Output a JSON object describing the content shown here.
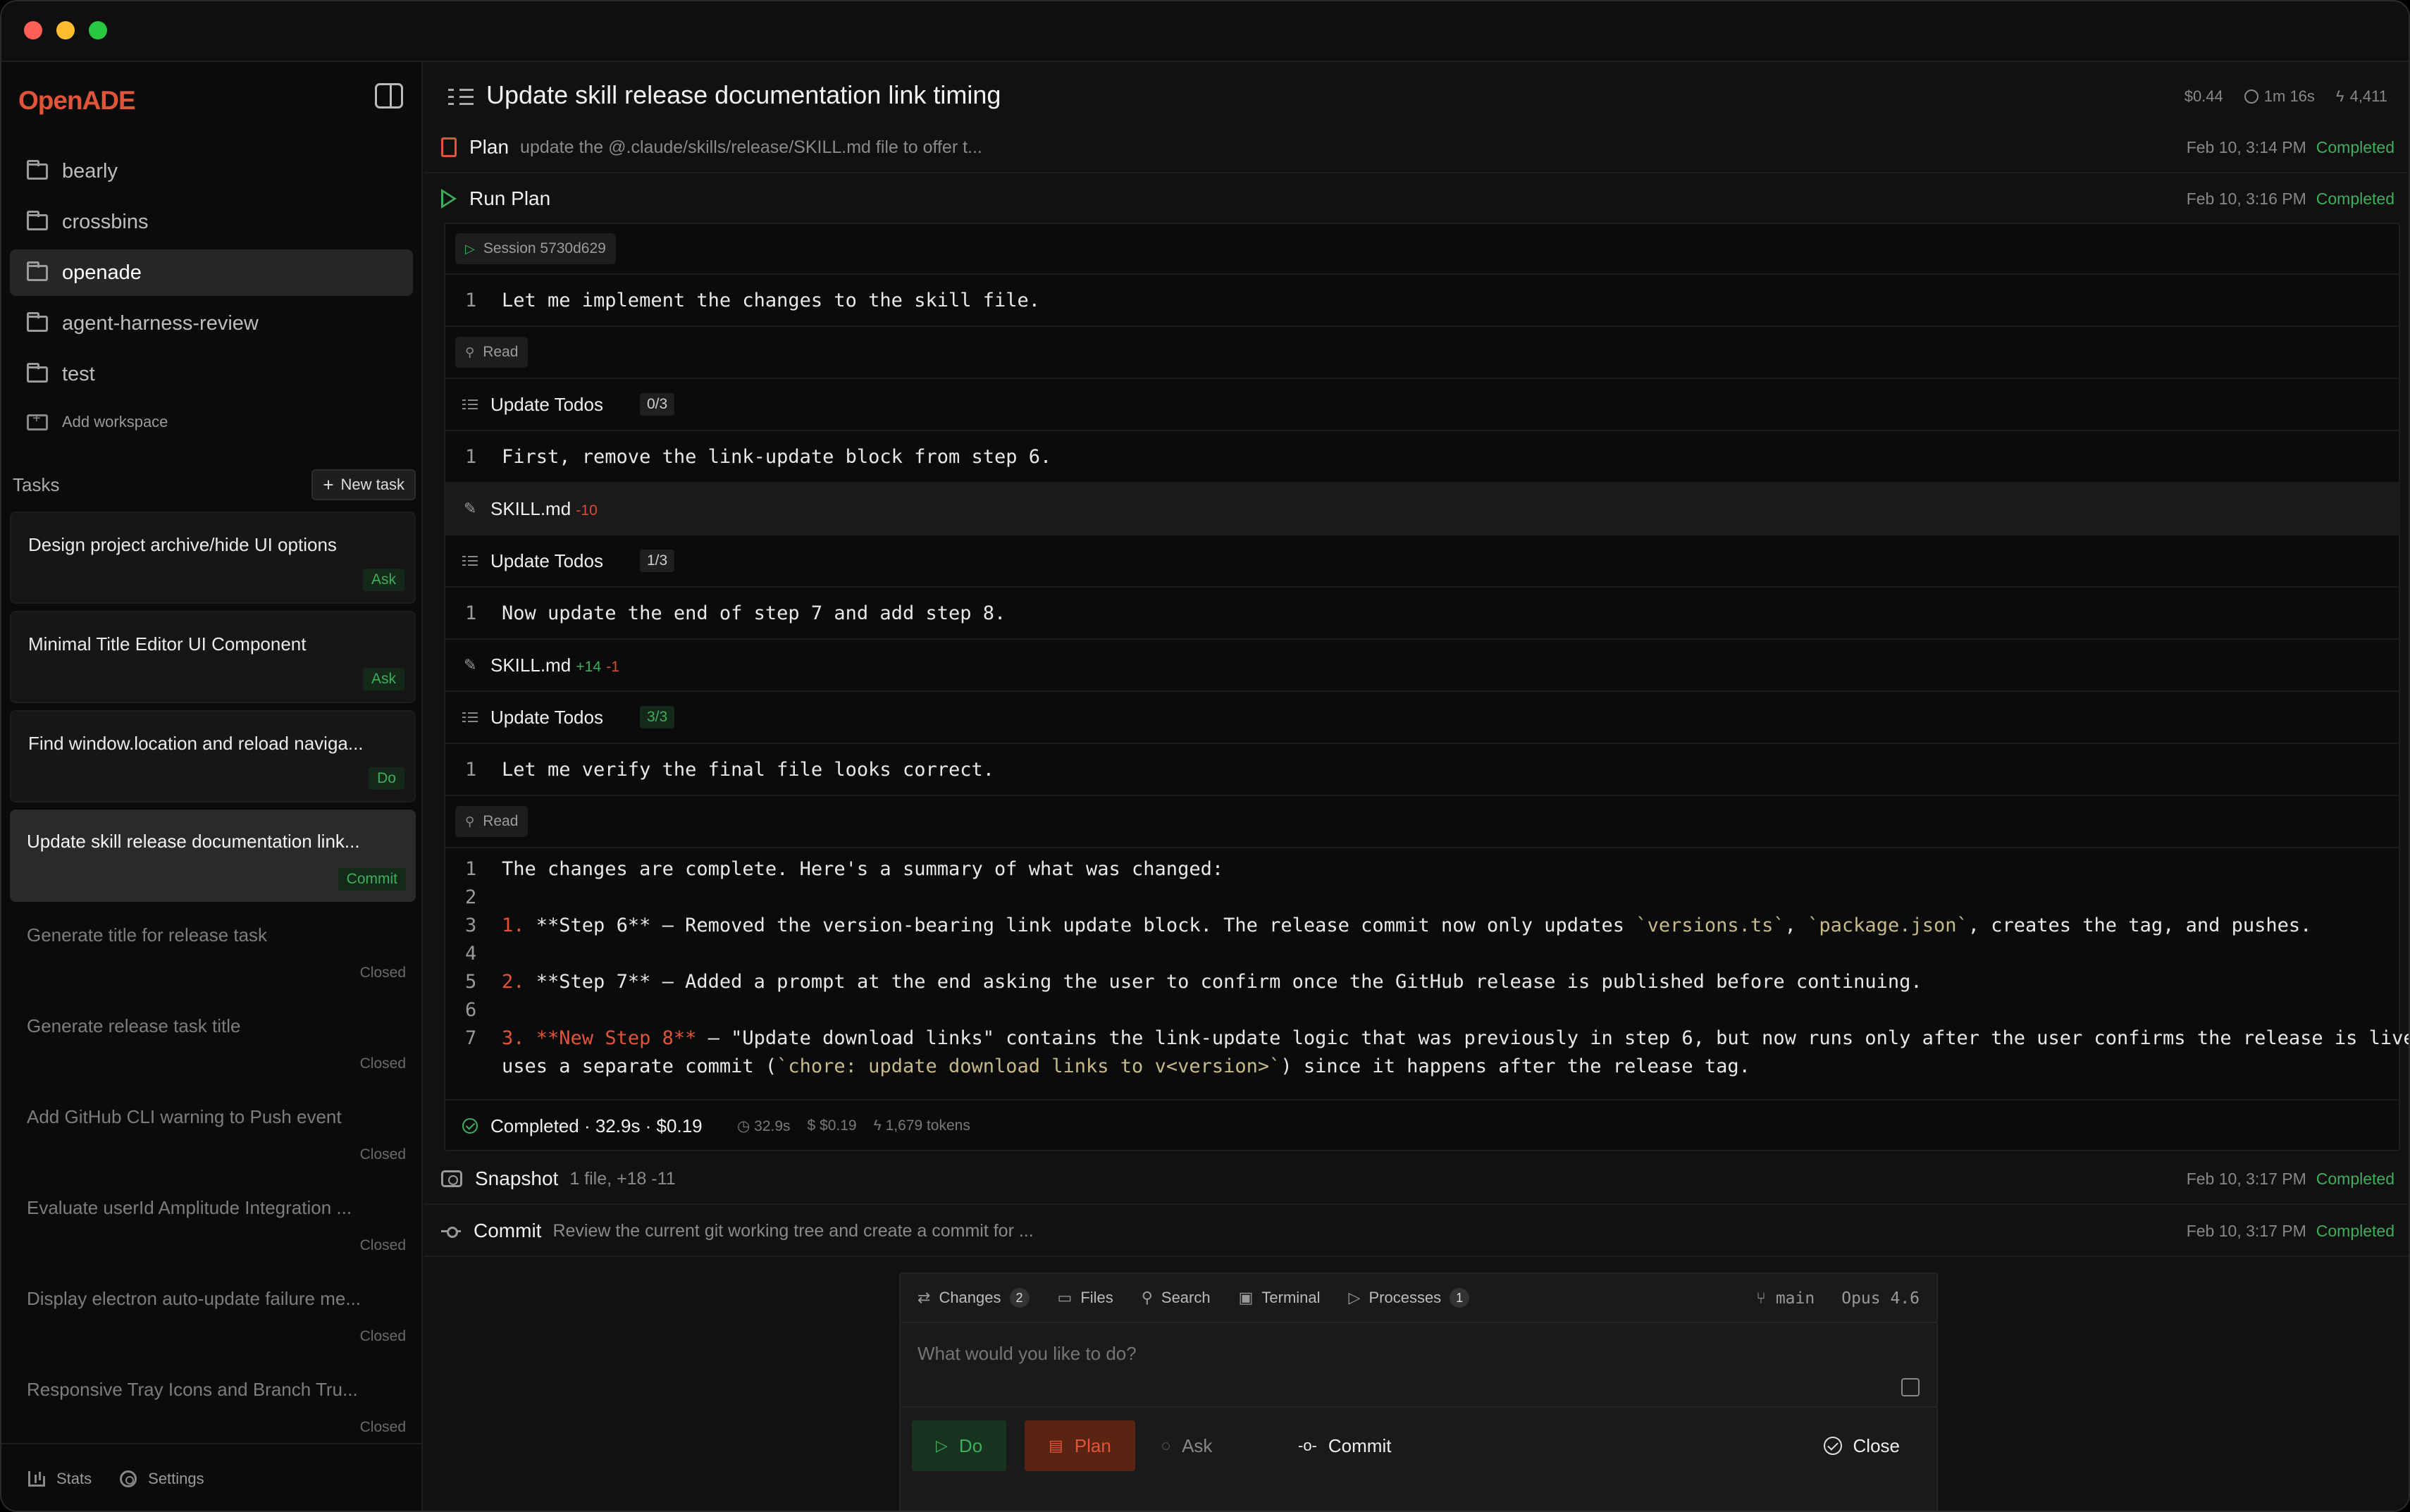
{
  "app": {
    "brand": "OpenADE"
  },
  "workspaces": [
    {
      "label": "bearly",
      "active": false
    },
    {
      "label": "crossbins",
      "active": false
    },
    {
      "label": "openade",
      "active": true
    },
    {
      "label": "agent-harness-review",
      "active": false
    },
    {
      "label": "test",
      "active": false
    }
  ],
  "add_workspace": "Add workspace",
  "tasks": {
    "title": "Tasks",
    "new_task": "New task",
    "items": [
      {
        "title": "Design project archive/hide UI options",
        "badge": "Ask",
        "state": "open"
      },
      {
        "title": "Minimal Title Editor UI Component",
        "badge": "Ask",
        "state": "open"
      },
      {
        "title": "Find window.location and reload naviga...",
        "badge": "Do",
        "state": "open"
      },
      {
        "title": "Update skill release documentation link...",
        "badge": "Commit",
        "state": "current"
      },
      {
        "title": "Generate title for release task",
        "badge": "Closed",
        "state": "closed"
      },
      {
        "title": "Generate release task title",
        "badge": "Closed",
        "state": "closed"
      },
      {
        "title": "Add GitHub CLI warning to Push event",
        "badge": "Closed",
        "state": "closed"
      },
      {
        "title": "Evaluate userId Amplitude Integration ...",
        "badge": "Closed",
        "state": "closed"
      },
      {
        "title": "Display electron auto-update failure me...",
        "badge": "Closed",
        "state": "closed"
      },
      {
        "title": "Responsive Tray Icons and Branch Tru...",
        "badge": "Closed",
        "state": "closed"
      }
    ]
  },
  "footer": {
    "stats": "Stats",
    "settings": "Settings"
  },
  "header": {
    "title": "Update skill release documentation link timing",
    "cost": "$0.44",
    "duration": "1m 16s",
    "tokens": "4,411"
  },
  "plan_row": {
    "label": "Plan",
    "desc": "update the @.claude/skills/release/SKILL.md file to offer t...",
    "time": "Feb 10, 3:14 PM",
    "status": "Completed"
  },
  "run_row": {
    "label": "Run Plan",
    "time": "Feb 10, 3:16 PM",
    "status": "Completed"
  },
  "session": {
    "chip": "Session 5730d629",
    "line1": {
      "n": "1",
      "text": "Let me implement the changes to the skill file."
    },
    "read1": "Read",
    "todos1": {
      "label": "Update Todos",
      "count": "0/3"
    },
    "line2": {
      "n": "1",
      "text": "First, remove the link-update block from step 6."
    },
    "file1": {
      "name": "SKILL.md",
      "del": "-10"
    },
    "todos2": {
      "label": "Update Todos",
      "count": "1/3"
    },
    "line3": {
      "n": "1",
      "text": "Now update the end of step 7 and add step 8."
    },
    "file2": {
      "name": "SKILL.md",
      "add": "+14",
      "del": "-1"
    },
    "todos3": {
      "label": "Update Todos",
      "count": "3/3"
    },
    "line4": {
      "n": "1",
      "text": "Let me verify the final file looks correct."
    },
    "read2": "Read",
    "summary": {
      "n1": "1",
      "t1": "The changes are complete. Here's a summary of what was changed:",
      "n2": "2",
      "n3": "3",
      "t3a": "1. ",
      "t3b": "**Step 6**",
      "t3c": " — Removed the version-bearing link update block. The release commit now only updates ",
      "t3d": "`versions.ts`",
      "t3e": ", ",
      "t3f": "`package.json`",
      "t3g": ", creates the tag, and pushes.",
      "n4": "4",
      "n5": "5",
      "t5a": "2. ",
      "t5b": "**Step 7**",
      "t5c": " — Added a prompt at the end asking the user to confirm once the GitHub release is published before continuing.",
      "n6": "6",
      "n7": "7",
      "t7a": "3. ",
      "t7b": "**New Step 8**",
      "t7c": " — \"Update download links\" contains the link-update logic that was previously in step 6, but now runs only after the user confirms the release is live. It",
      "t8a": "uses a separate commit (",
      "t8b": "`chore: update download links to v<version>`",
      "t8c": ") since it happens after the release tag."
    },
    "completed": {
      "text": "Completed · 32.9s · $0.19",
      "time": "32.9s",
      "cost": "$0.19",
      "tokens": "1,679 tokens"
    }
  },
  "snapshot_row": {
    "label": "Snapshot",
    "desc": "1 file, +18 -11",
    "time": "Feb 10, 3:17 PM",
    "status": "Completed"
  },
  "commit_row": {
    "label": "Commit",
    "desc": "Review the current git working tree and create a commit for ...",
    "time": "Feb 10, 3:17 PM",
    "status": "Completed"
  },
  "composer": {
    "tabs": [
      {
        "label": "Changes",
        "count": "2"
      },
      {
        "label": "Files"
      },
      {
        "label": "Search"
      },
      {
        "label": "Terminal"
      },
      {
        "label": "Processes",
        "count": "1"
      }
    ],
    "branch": "main",
    "model": "Opus 4.6",
    "placeholder": "What would you like to do?",
    "buttons": {
      "do": "Do",
      "plan": "Plan",
      "ask": "Ask",
      "commit": "Commit",
      "close": "Close"
    }
  }
}
